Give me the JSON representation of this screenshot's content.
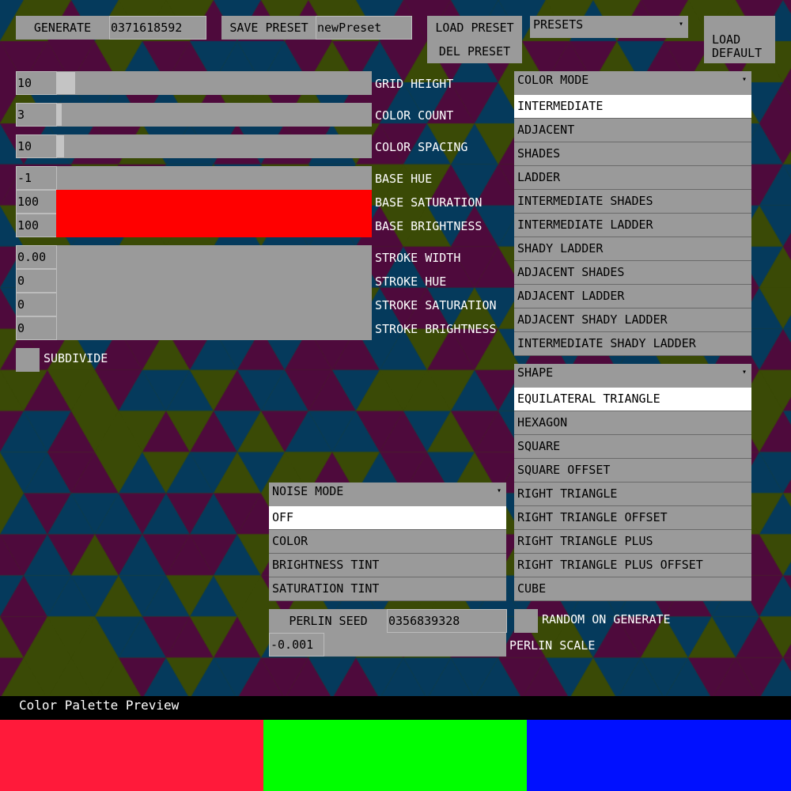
{
  "top": {
    "generate_label": "GENERATE",
    "seed_value": "0371618592",
    "save_preset_label": "SAVE PRESET",
    "preset_name_value": "newPreset",
    "load_preset_label": "LOAD PRESET",
    "del_preset_label": "DEL PRESET",
    "presets_label": "PRESETS",
    "load_default_line1": "LOAD",
    "load_default_line2": "DEFAULT"
  },
  "sliders": {
    "grid_height": {
      "value": "10",
      "label": "GRID HEIGHT",
      "level": 0.06
    },
    "color_count": {
      "value": "3",
      "label": "COLOR COUNT",
      "level": 0.02
    },
    "color_spacing": {
      "value": "10",
      "label": "COLOR SPACING",
      "level": 0.03
    },
    "base_hue": {
      "value": "-1",
      "label": "BASE HUE"
    },
    "base_saturation": {
      "value": "100",
      "label": "BASE SATURATION"
    },
    "base_brightness": {
      "value": "100",
      "label": "BASE BRIGHTNESS"
    },
    "stroke_width": {
      "value": "0.00",
      "label": "STROKE WIDTH"
    },
    "stroke_hue": {
      "value": "0",
      "label": "STROKE HUE"
    },
    "stroke_saturation": {
      "value": "0",
      "label": "STROKE SATURATION"
    },
    "stroke_brightness": {
      "value": "0",
      "label": "STROKE BRIGHTNESS"
    }
  },
  "subdivide_label": "SUBDIVIDE",
  "color_mode": {
    "label": "COLOR MODE",
    "options": [
      "INTERMEDIATE",
      "ADJACENT",
      "SHADES",
      "LADDER",
      "INTERMEDIATE SHADES",
      "INTERMEDIATE LADDER",
      "SHADY LADDER",
      "ADJACENT SHADES",
      "ADJACENT LADDER",
      "ADJACENT SHADY LADDER",
      "INTERMEDIATE SHADY LADDER"
    ],
    "selected": "INTERMEDIATE"
  },
  "shape": {
    "label": "SHAPE",
    "options": [
      "EQUILATERAL TRIANGLE",
      "HEXAGON",
      "SQUARE",
      "SQUARE OFFSET",
      "RIGHT TRIANGLE",
      "RIGHT TRIANGLE OFFSET",
      "RIGHT TRIANGLE PLUS",
      "RIGHT TRIANGLE PLUS OFFSET",
      "CUBE"
    ],
    "selected": "EQUILATERAL TRIANGLE"
  },
  "noise_mode": {
    "label": "NOISE MODE",
    "options": [
      "OFF",
      "COLOR",
      "BRIGHTNESS TINT",
      "SATURATION TINT"
    ],
    "selected": "OFF"
  },
  "perlin": {
    "seed_label": "PERLIN SEED",
    "seed_value": "0356839328",
    "random_label": "RANDOM ON GENERATE",
    "scale_value": "-0.001",
    "scale_label": "PERLIN SCALE"
  },
  "footer": {
    "title": "Color Palette Preview"
  },
  "colors": {
    "base_color": "#ff0000",
    "control_bg": "#9a9a9a",
    "pattern": [
      "#4e0a3c",
      "#3a4a06",
      "#053a5c"
    ],
    "palette": [
      "#ff1a3a",
      "#00ff00",
      "#0010ff"
    ]
  }
}
